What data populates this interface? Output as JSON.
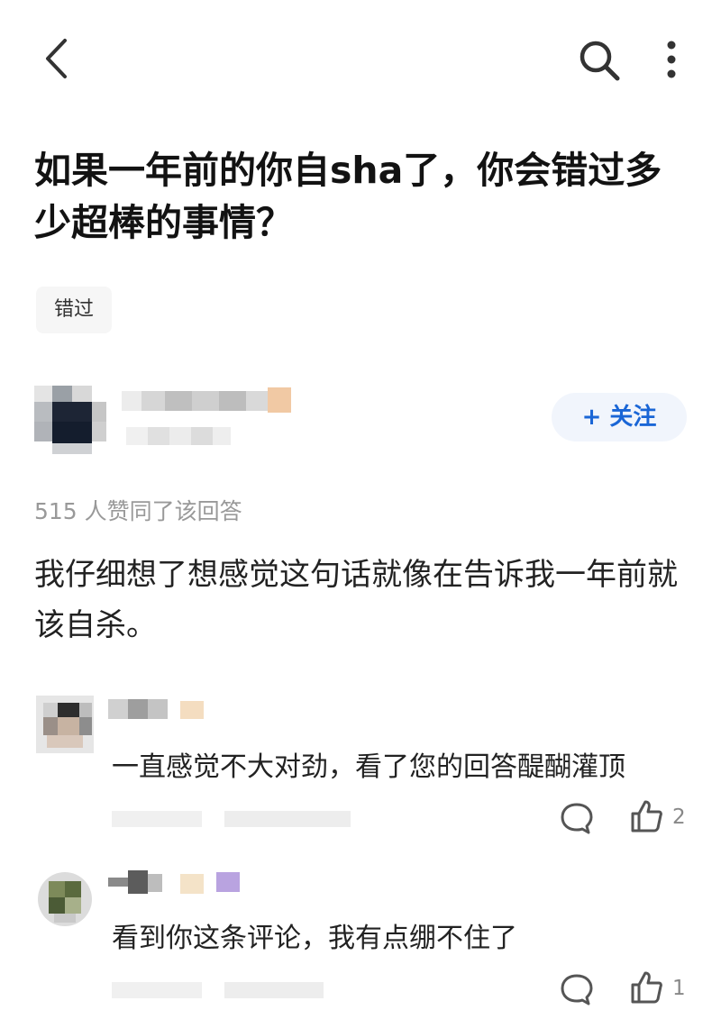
{
  "header": {
    "back": "chevron-left-icon",
    "search": "search-icon",
    "more": "more-vertical-icon"
  },
  "question": {
    "title": "如果一年前的你自sha了，你会错过多少超棒的事情？"
  },
  "topics": [
    "错过"
  ],
  "answer": {
    "follow_label": "+ 关注",
    "upvote_summary": "515 人赞同了该回答",
    "body": "我仔细想了想感觉这句话就像在告诉我一年前就该自杀。"
  },
  "comments": [
    {
      "text": "一直感觉不大对劲，看了您的回答醍醐灌顶",
      "like_count": "2"
    },
    {
      "text": "看到你这条评论，我有点绷不住了",
      "like_count": "1"
    }
  ],
  "colors": {
    "accent": "#1a66d6",
    "follow_bg": "#f1f5fc",
    "muted": "#999999"
  }
}
